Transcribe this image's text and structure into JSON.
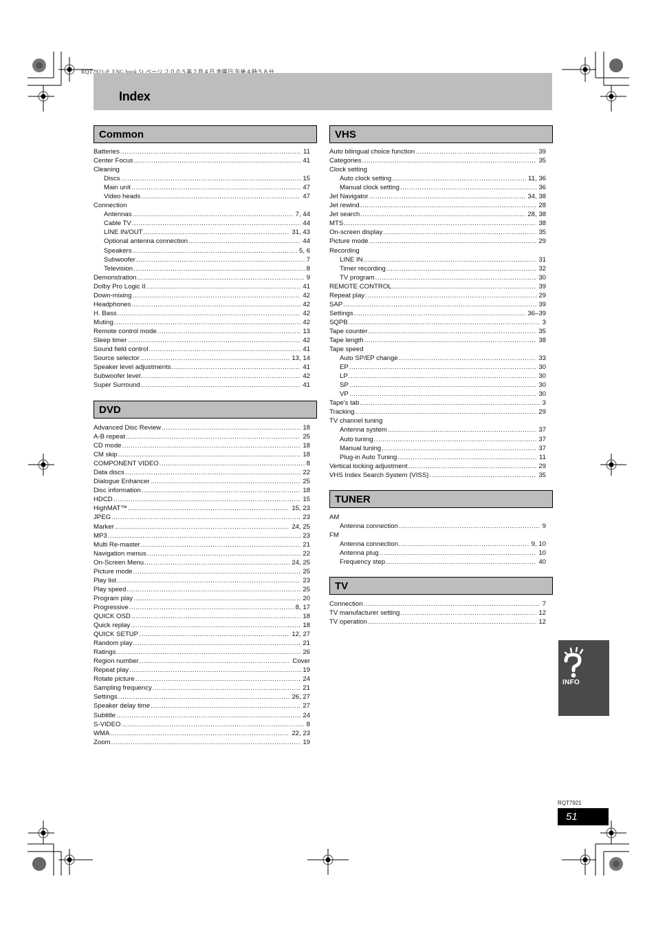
{
  "slug": "RQT7921-P_ENG.book  51 ページ  ２００５年２月４日  金曜日  午後４時５８分",
  "header": {
    "title": "Index"
  },
  "sections": {
    "common": {
      "title": "Common",
      "entries": [
        {
          "term": "Batteries",
          "page": "11"
        },
        {
          "term": "Center Focus",
          "page": "41"
        },
        {
          "term": "Cleaning",
          "page": ""
        },
        {
          "term": "Discs",
          "page": "15",
          "sub": true
        },
        {
          "term": "Main unit",
          "page": "47",
          "sub": true
        },
        {
          "term": "Video heads",
          "page": "47",
          "sub": true
        },
        {
          "term": "Connection",
          "page": ""
        },
        {
          "term": "Antennas",
          "page": "7, 44",
          "sub": true
        },
        {
          "term": "Cable TV",
          "page": "44",
          "sub": true
        },
        {
          "term": "LINE IN/OUT",
          "page": "31, 43",
          "sub": true
        },
        {
          "term": "Optional antenna connection",
          "page": "44",
          "sub": true
        },
        {
          "term": "Speakers",
          "page": "5, 6",
          "sub": true
        },
        {
          "term": "Subwoofer",
          "page": "7",
          "sub": true
        },
        {
          "term": "Television",
          "page": "8",
          "sub": true
        },
        {
          "term": "Demonstration",
          "page": "9"
        },
        {
          "term": "Dolby Pro Logic II",
          "page": "41"
        },
        {
          "term": "Down-mixing",
          "page": "42"
        },
        {
          "term": "Headphones",
          "page": "42"
        },
        {
          "term": "H. Bass",
          "page": "42"
        },
        {
          "term": "Muting",
          "page": "42"
        },
        {
          "term": "Remote control mode",
          "page": "13"
        },
        {
          "term": "Sleep timer",
          "page": "42"
        },
        {
          "term": "Sound field control",
          "page": "41"
        },
        {
          "term": "Source selector",
          "page": "13, 14"
        },
        {
          "term": "Speaker level adjustments",
          "page": "41"
        },
        {
          "term": "Subwoofer level",
          "page": "42"
        },
        {
          "term": "Super Surround",
          "page": "41"
        }
      ]
    },
    "dvd": {
      "title": "DVD",
      "entries": [
        {
          "term": "Advanced Disc Review",
          "page": "18"
        },
        {
          "term": "A-B repeat",
          "page": "25"
        },
        {
          "term": "CD mode",
          "page": "18"
        },
        {
          "term": "CM skip",
          "page": "18"
        },
        {
          "term": "COMPONENT VIDEO",
          "page": "8"
        },
        {
          "term": "Data discs",
          "page": "22"
        },
        {
          "term": "Dialogue Enhancer",
          "page": "25"
        },
        {
          "term": "Disc information",
          "page": "18"
        },
        {
          "term": "HDCD",
          "page": "15"
        },
        {
          "term": "HighMAT™",
          "page": "15, 23"
        },
        {
          "term": "JPEG",
          "page": "23"
        },
        {
          "term": "Marker",
          "page": "24, 25"
        },
        {
          "term": "MP3",
          "page": "23"
        },
        {
          "term": "Multi Re-master",
          "page": "21"
        },
        {
          "term": "Navigation menus",
          "page": "22"
        },
        {
          "term": "On-Screen Menu",
          "page": "24, 25"
        },
        {
          "term": "Picture mode",
          "page": "25"
        },
        {
          "term": "Play list",
          "page": "23"
        },
        {
          "term": "Play speed",
          "page": "25"
        },
        {
          "term": "Program play",
          "page": "20"
        },
        {
          "term": "Progressive",
          "page": "8, 17"
        },
        {
          "term": "QUICK OSD",
          "page": "18"
        },
        {
          "term": "Quick replay",
          "page": "18"
        },
        {
          "term": "QUICK SETUP",
          "page": "12, 27"
        },
        {
          "term": "Random play",
          "page": "21"
        },
        {
          "term": "Ratings",
          "page": "26"
        },
        {
          "term": "Region number",
          "page": "Cover"
        },
        {
          "term": "Repeat play",
          "page": "19"
        },
        {
          "term": "Rotate picture",
          "page": "24"
        },
        {
          "term": "Sampling frequency",
          "page": "21"
        },
        {
          "term": "Settings",
          "page": "26, 27"
        },
        {
          "term": "Speaker delay time",
          "page": "27"
        },
        {
          "term": "Subtitle",
          "page": "24"
        },
        {
          "term": "S-VIDEO",
          "page": "8"
        },
        {
          "term": "WMA",
          "page": "22, 23"
        },
        {
          "term": "Zoom",
          "page": "19"
        }
      ]
    },
    "vhs": {
      "title": "VHS",
      "entries": [
        {
          "term": "Auto bilingual choice function",
          "page": "39"
        },
        {
          "term": "Categories",
          "page": "35"
        },
        {
          "term": "Clock setting",
          "page": ""
        },
        {
          "term": "Auto clock setting",
          "page": "11, 36",
          "sub": true
        },
        {
          "term": "Manual clock setting",
          "page": "36",
          "sub": true
        },
        {
          "term": "Jet Navigator",
          "page": "34, 38"
        },
        {
          "term": "Jet rewind",
          "page": "28"
        },
        {
          "term": "Jet search",
          "page": "28, 38"
        },
        {
          "term": "MTS",
          "page": "38"
        },
        {
          "term": "On-screen display",
          "page": "35"
        },
        {
          "term": "Picture mode",
          "page": "29"
        },
        {
          "term": "Recording",
          "page": ""
        },
        {
          "term": "LINE IN",
          "page": "31",
          "sub": true
        },
        {
          "term": "Timer recording",
          "page": "32",
          "sub": true
        },
        {
          "term": "TV program",
          "page": "30",
          "sub": true
        },
        {
          "term": "REMOTE CONTROL",
          "page": "39"
        },
        {
          "term": "Repeat play",
          "page": "29"
        },
        {
          "term": "SAP",
          "page": "39"
        },
        {
          "term": "Settings",
          "page": "36–39"
        },
        {
          "term": "SQPB",
          "page": "3"
        },
        {
          "term": "Tape counter",
          "page": "35"
        },
        {
          "term": "Tape length",
          "page": "38"
        },
        {
          "term": "Tape speed",
          "page": ""
        },
        {
          "term": "Auto SP/EP change",
          "page": "33",
          "sub": true
        },
        {
          "term": "EP",
          "page": "30",
          "sub": true
        },
        {
          "term": "LP",
          "page": "30",
          "sub": true
        },
        {
          "term": "SP",
          "page": "30",
          "sub": true
        },
        {
          "term": "VP",
          "page": "30",
          "sub": true
        },
        {
          "term": "Tape's tab",
          "page": "3"
        },
        {
          "term": "Tracking",
          "page": "29"
        },
        {
          "term": "TV channel tuning",
          "page": ""
        },
        {
          "term": "Antenna system",
          "page": "37",
          "sub": true
        },
        {
          "term": "Auto tuning",
          "page": "37",
          "sub": true
        },
        {
          "term": "Manual tuning",
          "page": "37",
          "sub": true
        },
        {
          "term": "Plug-in Auto Tuning",
          "page": "11",
          "sub": true
        },
        {
          "term": "Vertical locking adjustment",
          "page": "29"
        },
        {
          "term": "VHS Index Search System (VISS)",
          "page": "35"
        }
      ]
    },
    "tuner": {
      "title": "TUNER",
      "entries": [
        {
          "term": "AM",
          "page": ""
        },
        {
          "term": "Antenna connection",
          "page": "9",
          "sub": true
        },
        {
          "term": "FM",
          "page": ""
        },
        {
          "term": "Antenna connection",
          "page": "9, 10",
          "sub": true
        },
        {
          "term": "Antenna plug",
          "page": "10",
          "sub": true
        },
        {
          "term": "Frequency step",
          "page": "40",
          "sub": true
        }
      ]
    },
    "tv": {
      "title": "TV",
      "entries": [
        {
          "term": "Connection",
          "page": "7"
        },
        {
          "term": "TV manufacturer setting",
          "page": "12"
        },
        {
          "term": "TV operation",
          "page": "12"
        }
      ]
    }
  },
  "side_tab": {
    "label": "INFO",
    "icon": "question-mark-icon"
  },
  "footer": {
    "doc_code": "RQT7921",
    "page_number": "51"
  },
  "colors": {
    "band_gray": "#bdbdbd",
    "tab_dark": "#4a4a4a",
    "page_box": "#000000"
  }
}
